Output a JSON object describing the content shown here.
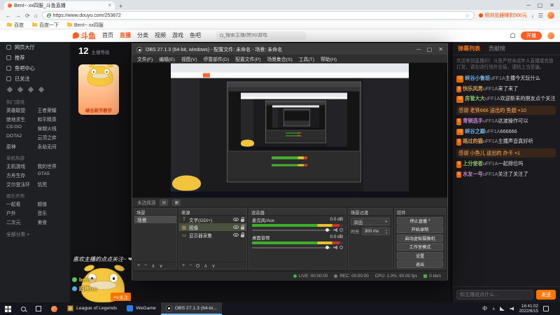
{
  "browser": {
    "tab_title": "Bent~·xx四服_斗鱼直播",
    "new_tab": "+",
    "url": "https://www.douyu.com/253872",
    "promo": "用浏览器赚到500元",
    "bookmarks": [
      "百度",
      "百度一下",
      "Bent~·xx四服"
    ]
  },
  "nav": {
    "logo": "斗鱼",
    "items": [
      {
        "label": "首页"
      },
      {
        "label": "直播",
        "active": true
      },
      {
        "label": "分类"
      },
      {
        "label": "视频"
      },
      {
        "label": "游戏"
      },
      {
        "label": "鱼吧"
      }
    ],
    "search_placeholder": "搜索主播/房间/游戏",
    "live_button": "开播"
  },
  "sidebar": {
    "main": [
      {
        "label": "网页大厅"
      },
      {
        "label": "推荐"
      },
      {
        "label": "鱼吧中心"
      },
      {
        "label": "已关注"
      }
    ],
    "sections": [
      {
        "title": "热门游戏"
      },
      {
        "title": "单机热游"
      },
      {
        "title": "娱乐天地"
      }
    ],
    "sec0_items": [
      "英雄联盟",
      "王者荣耀",
      "绝地求生",
      "和平精英",
      "CS:GO",
      "穿越火线",
      "DOTA2",
      "云顶之弈",
      "原神",
      "永劫无间"
    ],
    "sec1_items": [
      "主机游戏",
      "我的世界",
      "方舟生存",
      "GTA5",
      "艾尔登法环",
      "饥荒"
    ],
    "sec2_items": [
      "一起看",
      "颜值",
      "户外",
      "音乐",
      "二次元",
      "美食"
    ],
    "more": "全部分类 >"
  },
  "stream": {
    "level": "12",
    "level_label": "主播等级",
    "card_title": "峡谷新手教学",
    "overlay_title": "喜欢主播的点点关注~ ❤",
    "contacts": [
      {
        "icon": "wechat-icon",
        "value": "bentxc"
      },
      {
        "icon": "qq-icon",
        "value": "四神txc"
      }
    ],
    "follow_tag": "+V关注"
  },
  "chat": {
    "tabs": [
      {
        "label": "弹幕列表",
        "active": true
      },
      {
        "label": "贡献榜"
      }
    ],
    "notice": "欢迎来到直播间！斗鱼严禁未成年人直播或充值打赏，请勿进行场外交易，谨防上当受骗。",
    "messages": [
      {
        "badge": "12",
        "user": "峡谷小鲁班",
        "color": "#6fb3e0",
        "text": "主播今天玩什么"
      },
      {
        "badge": "8",
        "user": "快乐风男",
        "color": "#e0a458",
        "text": "来了来了"
      },
      {
        "badge": "20",
        "user": "房管大大",
        "color": "#8cc46a",
        "text": "欢迎新来的朋友点个关注"
      },
      {
        "gift": true,
        "text": "感谢 老铁666 送出的 鱼翅 ×10"
      },
      {
        "badge": "5",
        "user": "青铜选手",
        "color": "#c98bd4",
        "text": "这波操作可以"
      },
      {
        "badge": "15",
        "user": "峡谷之巅",
        "color": "#6fb3e0",
        "text": "666666"
      },
      {
        "badge": "3",
        "user": "路过的猫",
        "color": "#e0a458",
        "text": "主播声音真好听"
      },
      {
        "gift": true,
        "text": "感谢 小鱼儿 送出的 办卡 ×1"
      },
      {
        "badge": "9",
        "user": "上分使者",
        "color": "#8cc46a",
        "text": "一起排位吗"
      },
      {
        "badge": "6",
        "user": "水友一号",
        "color": "#c98bd4",
        "text": "关注了关注了"
      }
    ],
    "input_placeholder": "和主播说点什么...",
    "send_label": "发送"
  },
  "obs": {
    "title": "OBS 27.1.3 (64-bit, windows) - 配置文件: 未命名 - 场景: 未命名",
    "menus": [
      "文件(F)",
      "编辑(E)",
      "视图(V)",
      "停靠部件(D)",
      "配置文件(P)",
      "场景集合(S)",
      "工具(T)",
      "帮助(H)"
    ],
    "context_label": "未选择源",
    "scenes": {
      "title": "场景",
      "items": [
        {
          "name": "场景",
          "selected": true
        }
      ]
    },
    "sources": {
      "title": "来源",
      "items": [
        {
          "glyph": "T",
          "name": "文字(GDI+)"
        },
        {
          "glyph": "▨",
          "name": "图像",
          "selected": true
        },
        {
          "glyph": "▭",
          "name": "显示器采集"
        }
      ]
    },
    "mixer": {
      "title": "混音器",
      "channels": [
        {
          "name": "麦克风/Aux",
          "db": "0.0 dB"
        },
        {
          "name": "桌面音频",
          "db": "0.0 dB"
        }
      ]
    },
    "transitions": {
      "title": "场景过渡",
      "type": "淡出",
      "duration_label": "时长",
      "duration": "300 ms"
    },
    "controls": {
      "title": "控件",
      "buttons": [
        {
          "label": "停止直播",
          "dropdown": true
        },
        {
          "label": "开始录制"
        },
        {
          "label": "启动虚拟摄像机"
        },
        {
          "label": "工作室模式"
        },
        {
          "label": "设置"
        },
        {
          "label": "退出"
        }
      ]
    },
    "status": {
      "live": "LIVE: 00:00:00",
      "rec": "REC: 00:00:00",
      "cpu": "CPU: 1.0%, 60.00 fps",
      "kbps": "0 kb/s"
    }
  },
  "taskbar": {
    "tasks": [
      {
        "icon": "lol-icon",
        "label": "League of Legends"
      },
      {
        "icon": "wegame-icon",
        "label": "WeGame"
      },
      {
        "icon": "obs-icon",
        "label": "OBS 27.1.3 (64-bi...",
        "active": true
      }
    ],
    "tray": {
      "ime": "中",
      "time": "16:41:02",
      "date": "2022/6/15"
    }
  }
}
